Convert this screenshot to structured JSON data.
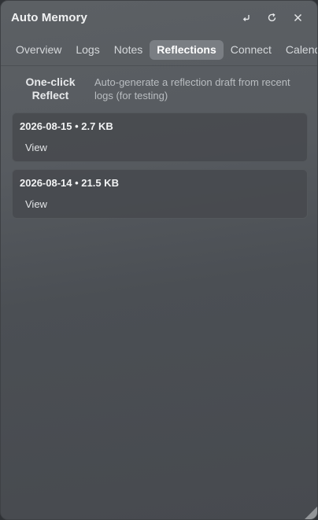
{
  "window": {
    "title": "Auto Memory",
    "actions": [
      {
        "icon": "return-icon"
      },
      {
        "icon": "refresh-icon"
      },
      {
        "icon": "close-icon"
      }
    ]
  },
  "tabs": [
    {
      "label": "Overview",
      "active": false
    },
    {
      "label": "Logs",
      "active": false
    },
    {
      "label": "Notes",
      "active": false
    },
    {
      "label": "Reflections",
      "active": true
    },
    {
      "label": "Connect",
      "active": false
    },
    {
      "label": "Calendar",
      "active": false
    }
  ],
  "reflect": {
    "button_line1": "One-click",
    "button_line2": "Reflect",
    "description_line1": "Auto-generate a reflection draft from recent",
    "description_line2": "logs (for testing)"
  },
  "reflections": [
    {
      "title": "2026-08-15 • 2.7 KB",
      "action": "View"
    },
    {
      "title": "2026-08-14 • 21.5 KB",
      "action": "View"
    }
  ],
  "colors": {
    "active_tab_bg": "#7a7e83",
    "panel_bg": "#575b60"
  }
}
